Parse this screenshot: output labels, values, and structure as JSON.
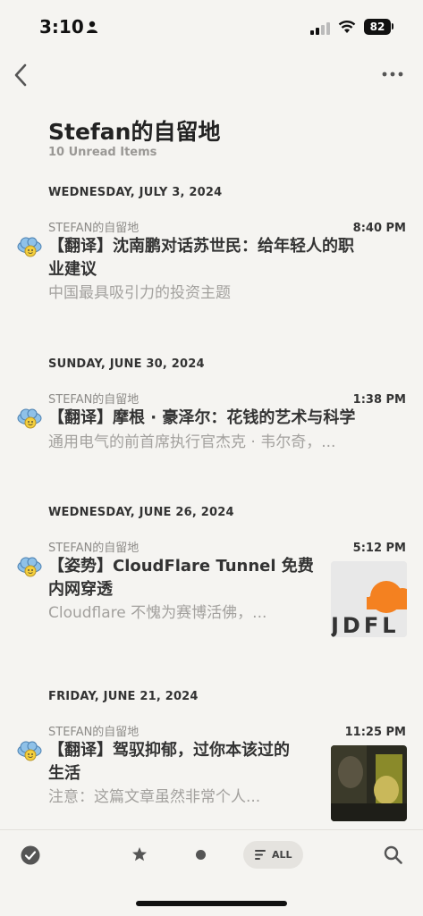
{
  "status_bar": {
    "time": "3:10",
    "battery": "82"
  },
  "nav": {
    "back_icon": "chevron-left-icon",
    "more_icon": "ellipsis-icon"
  },
  "feed": {
    "title": "Stefan的自留地",
    "unread": "10 Unread Items"
  },
  "groups": [
    {
      "date": "WEDNESDAY, JULY 3, 2024",
      "entry": {
        "source": "STEFAN的自留地",
        "time": "8:40 PM",
        "title_line1": "【翻译】沈南鹏对话苏世民：给年轻人的职",
        "title_line2": "业建议",
        "summary": "中国最具吸引力的投资主题"
      }
    },
    {
      "date": "SUNDAY, JUNE 30, 2024",
      "entry": {
        "source": "STEFAN的自留地",
        "time": "1:38 PM",
        "title_line1": "【翻译】摩根 · 豪泽尔：花钱的艺术与科学",
        "title_line2": "",
        "summary": "通用电气的前首席执行官杰克 · 韦尔奇，..."
      }
    },
    {
      "date": "WEDNESDAY, JUNE 26, 2024",
      "entry": {
        "source": "STEFAN的自留地",
        "time": "5:12 PM",
        "title_line1": "【姿势】CloudFlare Tunnel 免费",
        "title_line2": "内网穿透",
        "summary": "Cloudflare 不愧为赛博活佛，...",
        "thumb_text": "JDFL"
      }
    },
    {
      "date": "FRIDAY, JUNE 21, 2024",
      "entry": {
        "source": "STEFAN的自留地",
        "time": "11:25 PM",
        "title_line1": "【翻译】驾驭抑郁，过你本该过的",
        "title_line2": "生活",
        "summary": "注意：这篇文章虽然非常个人..."
      }
    }
  ],
  "tabbar": {
    "all_label": "ALL",
    "icons": [
      "checkmark-circle-icon",
      "star-icon",
      "dot-icon",
      "list-icon",
      "search-icon"
    ]
  },
  "colors": {
    "background": "#f5f4f1",
    "cloud": "#8fc1e8",
    "sun": "#f4cf3d",
    "cloudflare_orange": "#f48120"
  }
}
